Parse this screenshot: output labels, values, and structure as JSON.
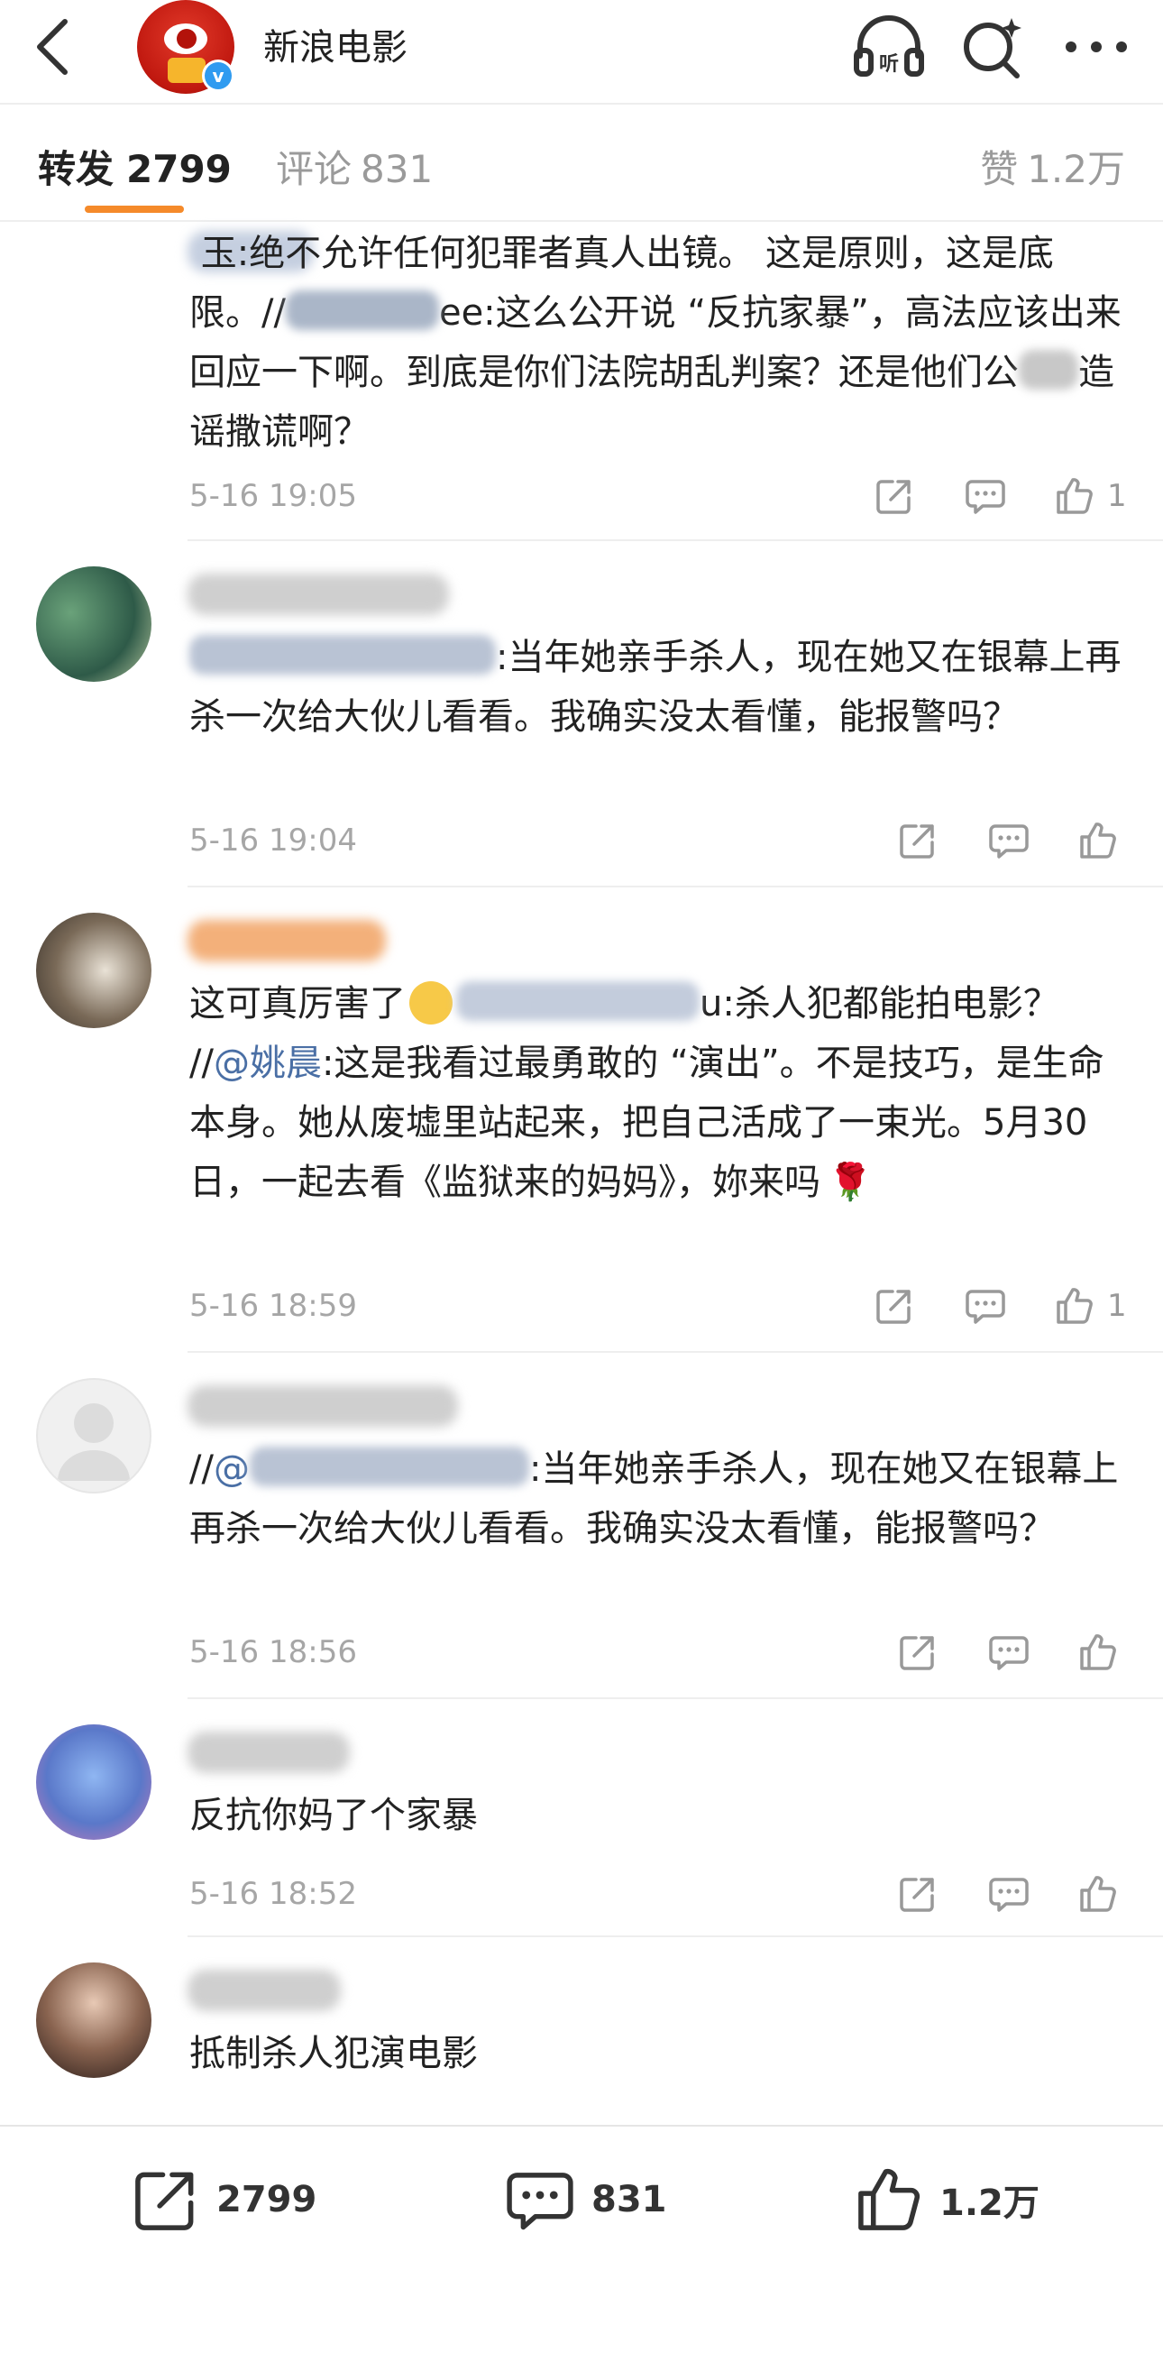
{
  "header": {
    "title": "新浪电影",
    "verified_badge": "v"
  },
  "tabs": {
    "repost_label": "转发",
    "repost_count": "2799",
    "comments_label": "评论",
    "comments_count": "831",
    "likes_label": "赞",
    "likes_count": "1.2万"
  },
  "feed": [
    {
      "text_before": "玉:绝不允许任何犯罪者真人出镜。 这是原则，这是底限。//",
      "text_after": "ee:这么公开说 “反抗家暴”，高法应该出来回应一下啊。到底是你们法院胡乱判案？还是他们公",
      "text_after2": "造谣撒谎啊？",
      "time": "5-16 19:05",
      "like_count": "1"
    },
    {
      "text": ":当年她亲手杀人，现在她又在银幕上再杀一次给大伙儿看看。我确实没太看懂，能报警吗？",
      "time": "5-16 19:04",
      "like_count": ""
    },
    {
      "text_before": "这可真厉害了",
      "text_mid": "u:杀人犯都能拍电影？ //",
      "mention": "@姚晨",
      "text_after": ":这是我看过最勇敢的 “演出”。不是技巧，是生命本身。她从废墟里站起来，把自己活成了一束光。5月30日，一起去看《监狱来的妈妈》，妳来吗",
      "time": "5-16 18:59",
      "like_count": "1"
    },
    {
      "prefix": "//",
      "mention": "@",
      "text": ":当年她亲手杀人，现在她又在银幕上再杀一次给大伙儿看看。我确实没太看懂，能报警吗？",
      "time": "5-16 18:56",
      "like_count": ""
    },
    {
      "text": "反抗你妈了个家暴",
      "time": "5-16 18:52",
      "like_count": ""
    },
    {
      "text": "抵制杀人犯演电影",
      "time": "",
      "like_count": ""
    }
  ],
  "bottom_bar": {
    "repost_count": "2799",
    "comments_count": "831",
    "likes_count": "1.2万"
  },
  "colors": {
    "accent_orange": "#f58a2a",
    "mention_blue": "#4a6fa5",
    "meta_gray": "#a6a6a6"
  }
}
